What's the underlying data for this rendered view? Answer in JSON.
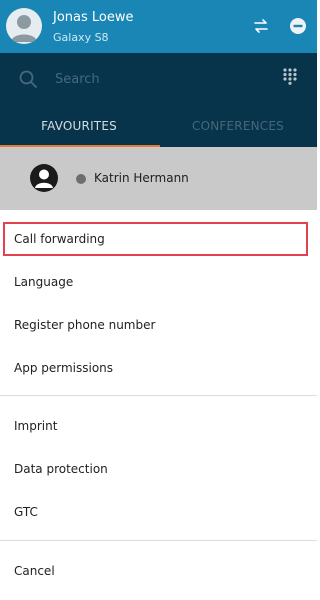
{
  "user": {
    "name": "Jonas Loewe",
    "device": "Galaxy S8"
  },
  "search": {
    "placeholder": "Search"
  },
  "tabs": [
    {
      "label": "FAVOURITES"
    },
    {
      "label": "CONFERENCES"
    }
  ],
  "favourite": {
    "name": "Katrin Hermann"
  },
  "menu": {
    "group1": [
      {
        "label": "Call forwarding"
      },
      {
        "label": "Language"
      },
      {
        "label": "Register phone number"
      },
      {
        "label": "App permissions"
      }
    ],
    "group2": [
      {
        "label": "Imprint"
      },
      {
        "label": "Data protection"
      },
      {
        "label": "GTC"
      }
    ],
    "cancel_label": "Cancel"
  },
  "colors": {
    "topbar": "#1a86b5",
    "header_dark": "#07344b",
    "tab_indicator": "#e07b3b",
    "highlight": "#e2424f"
  },
  "icons": {
    "avatar": "person-avatar-icon",
    "switch": "switch-arrows-icon",
    "status": "minus-circle-icon",
    "search": "search-icon",
    "dialpad": "dialpad-icon",
    "presence": "presence-dot-icon"
  }
}
